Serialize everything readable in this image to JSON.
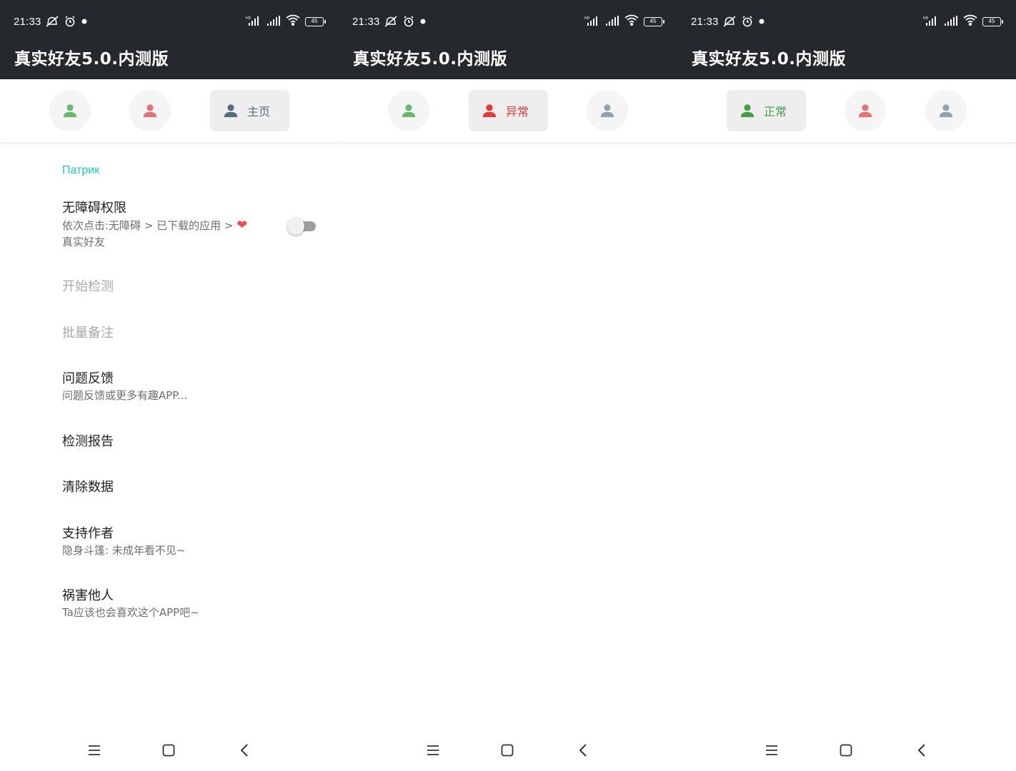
{
  "colors": {
    "header_bg": "#25292d",
    "green_user": "#4caf50",
    "red_user": "#e53935",
    "gray_user": "#607d8b",
    "category": "#1ec8c8"
  },
  "screens": [
    {
      "status": {
        "time": "21:33",
        "battery": "45"
      },
      "title": "真实好友5.0.内测版",
      "active_tab": {
        "label": "主页"
      },
      "settings": {
        "category": "Патрик",
        "items": [
          {
            "title": "无障碍权限",
            "subtitle_line1": "依次点击:无障碍 > 已下载的应用 > ",
            "subtitle_line2": "真实好友",
            "heart": "❤"
          },
          {
            "title": "开始检测"
          },
          {
            "title": "批量备注"
          },
          {
            "title": "问题反馈",
            "subtitle": "问题反馈或更多有趣APP..."
          },
          {
            "title": "检测报告"
          },
          {
            "title": "清除数据"
          },
          {
            "title": "支持作者",
            "subtitle": "隐身斗篷: 未成年看不见~"
          },
          {
            "title": "祸害他人",
            "subtitle": "Ta应该也会喜欢这个APP吧~"
          }
        ]
      }
    },
    {
      "status": {
        "time": "21:33",
        "battery": "45"
      },
      "title": "真实好友5.0.内测版",
      "active_tab": {
        "label": "异常"
      }
    },
    {
      "status": {
        "time": "21:33",
        "battery": "45"
      },
      "title": "真实好友5.0.内测版",
      "active_tab": {
        "label": "正常"
      }
    }
  ],
  "icons": {
    "user": "user-icon",
    "menu": "menu-icon",
    "home": "home-icon",
    "back": "back-icon"
  }
}
